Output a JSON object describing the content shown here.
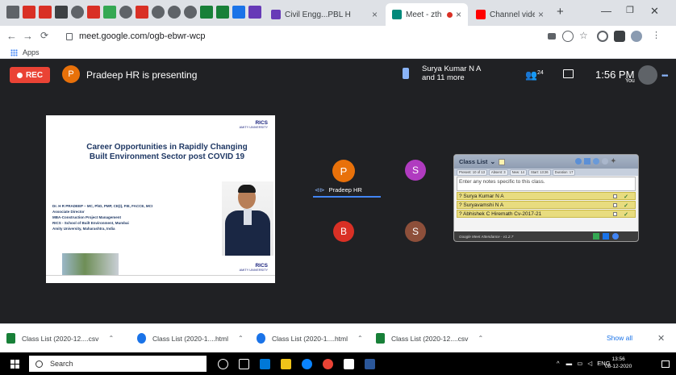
{
  "browser": {
    "tabs": [
      {
        "title": "Civil Engg...PBL H",
        "active": false
      },
      {
        "title": "Meet - zth",
        "active": true
      },
      {
        "title": "Channel videos",
        "active": false
      }
    ],
    "url": "meet.google.com/ogb-ebwr-wcp",
    "bookmarks_label": "Apps",
    "colors": {
      "accent": "#1a73e8",
      "meet_bg": "#202124",
      "rec": "#ea4335"
    }
  },
  "meet": {
    "rec_label": "REC",
    "presenter_initial": "P",
    "presenter_text": "Pradeep HR is presenting",
    "speaker_line1": "Surya Kumar N A",
    "speaker_line2": "and 11 more",
    "people_count": "24",
    "time": "1:56 PM",
    "you_label": "You",
    "participants": [
      {
        "initial": "P",
        "name": "Pradeep HR",
        "color": "#e8710a"
      },
      {
        "initial": "S",
        "color": "#b03bc0"
      },
      {
        "initial": "B",
        "color": "#d93025"
      },
      {
        "initial": "S",
        "color": "#8d4f3a"
      }
    ]
  },
  "slide": {
    "logo_line1": "RICS",
    "logo_line2": "AMITY UNIVERSITY",
    "title_line1": "Career Opportunities in Rapidly Changing",
    "title_line2": "Built Environment Sector post COVID 19",
    "bio_line1": "Dr. H R PRADEEP – MC, PhD, PMP, CE(I), FIE, FACCE, MCI",
    "bio_line2": "Associate Director",
    "bio_line3": "MBA-Construction Project Management",
    "bio_line4": "RICS - School of Built Environment, Mumbai",
    "bio_line5": "Amity University, Maharashtra, India"
  },
  "classlist": {
    "title": "Class List",
    "filters": [
      "Present: 10 of 13",
      "Absent: 3",
      "New: 14",
      "Start: 13:26",
      "Duration: 17"
    ],
    "notes_placeholder": "Enter any notes specific to this class.",
    "rows": [
      "? Surya Kumar N A",
      "? Suryavamshi N A",
      "? Abhishek C Hiremath Cv-2017-21"
    ],
    "footer": "Google Meet Attendance - v1.2.7"
  },
  "downloads": {
    "items": [
      {
        "name": "Class List (2020-12....csv",
        "icon_color": "#188038"
      },
      {
        "name": "Class List (2020-1....html",
        "icon_color": "#1a73e8"
      },
      {
        "name": "Class List (2020-1....html",
        "icon_color": "#1a73e8"
      },
      {
        "name": "Class List (2020-12....csv",
        "icon_color": "#188038"
      }
    ],
    "show_all": "Show all"
  },
  "taskbar": {
    "search_label": "Search",
    "lang": "ENG",
    "time": "13:56",
    "date": "08-12-2020"
  }
}
